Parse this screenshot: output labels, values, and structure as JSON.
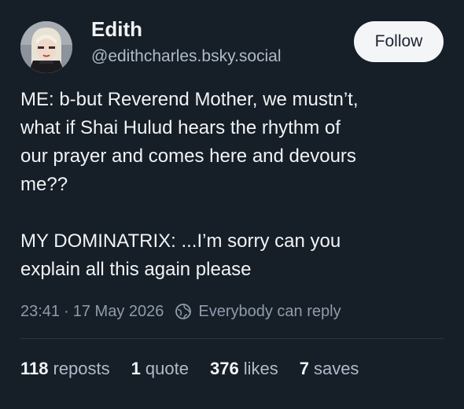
{
  "author": {
    "display_name": "Edith",
    "handle": "@edithcharles.bsky.social"
  },
  "follow_label": "Follow",
  "post": {
    "paragraphs": [
      "ME: b-but Reverend Mother, we mustn’t,\nwhat if Shai Hulud hears the rhythm of\nour prayer and comes here and devours\nme??",
      "MY DOMINATRIX: ...I’m sorry can you\nexplain all this again please"
    ]
  },
  "meta": {
    "time": "23:41",
    "separator": "·",
    "date": "17 May 2026",
    "reply_setting": "Everybody can reply"
  },
  "stats": {
    "reposts": {
      "count": "118",
      "label": "reposts"
    },
    "quotes": {
      "count": "1",
      "label": "quote"
    },
    "likes": {
      "count": "376",
      "label": "likes"
    },
    "saves": {
      "count": "7",
      "label": "saves"
    }
  },
  "icons": {
    "reply_setting_icon": "everybody-can-reply-icon"
  },
  "colors": {
    "background": "#161e27",
    "text": "#f1f3f5",
    "muted": "#8f9cab",
    "follow_button": "#f4f5f7"
  }
}
